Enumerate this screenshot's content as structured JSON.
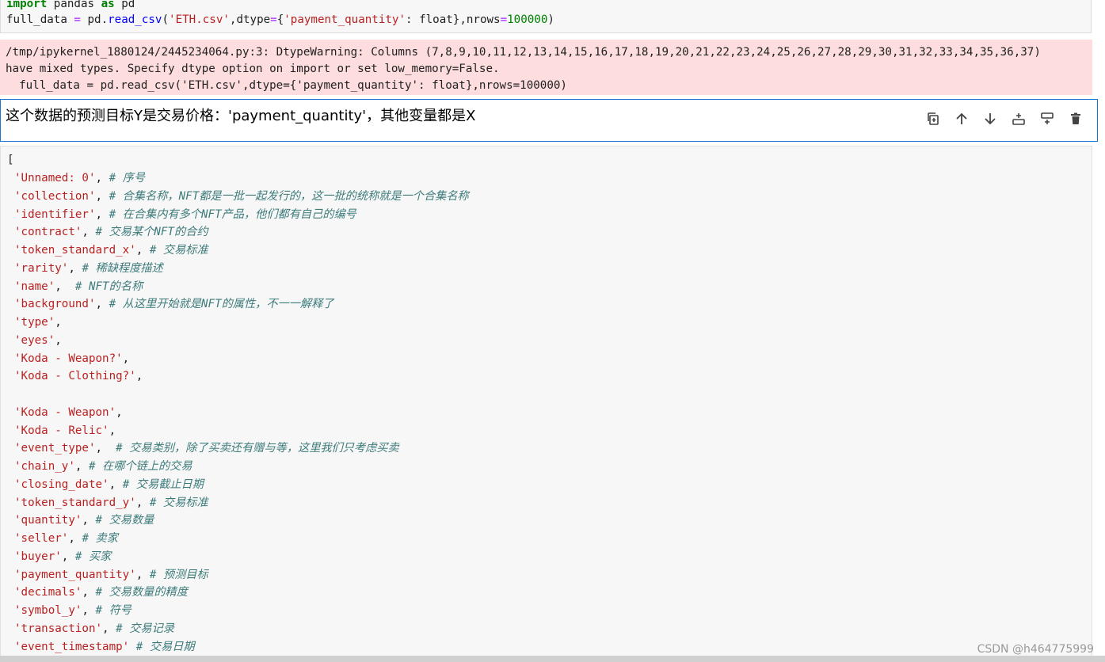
{
  "code_cell": {
    "line1": {
      "kw1": "import",
      "mid": " pandas ",
      "kw2": "as",
      "end": " pd"
    },
    "line2": {
      "a": "full_data ",
      "eq": "=",
      "b": " pd.",
      "fn": "read_csv",
      "c": "(",
      "s1": "'ETH.csv'",
      "d": ",dtype",
      "eq2": "=",
      "e": "{",
      "s2": "'payment_quantity'",
      "f": ": float},nrows",
      "eq3": "=",
      "num": "100000",
      "g": ")"
    }
  },
  "warning": {
    "line1": "/tmp/ipykernel_1880124/2445234064.py:3: DtypeWarning: Columns (7,8,9,10,11,12,13,14,15,16,17,18,19,20,21,22,23,24,25,26,27,28,29,30,31,32,33,34,35,36,37)",
    "line2": "have mixed types. Specify dtype option on import or set low_memory=False.",
    "line3": "  full_data = pd.read_csv('ETH.csv',dtype={'payment_quantity': float},nrows=100000)"
  },
  "markdown": {
    "text": "这个数据的预测目标Y是交易价格：'payment_quantity'，其他变量都是X"
  },
  "list": {
    "open": "[",
    "items": [
      {
        "name": "'Unnamed: 0'",
        "sep": ", ",
        "comment": "# 序号"
      },
      {
        "name": "'collection'",
        "sep": ", ",
        "comment": "# 合集名称，NFT都是一批一起发行的，这一批的统称就是一个合集名称"
      },
      {
        "name": "'identifier'",
        "sep": ", ",
        "comment": "# 在合集内有多个NFT产品，他们都有自己的编号"
      },
      {
        "name": "'contract'",
        "sep": ", ",
        "comment": "# 交易某个NFT的合约"
      },
      {
        "name": "'token_standard_x'",
        "sep": ", ",
        "comment": "# 交易标准"
      },
      {
        "name": "'rarity'",
        "sep": ", ",
        "comment": "# 稀缺程度描述"
      },
      {
        "name": "'name'",
        "sep": ",  ",
        "comment": "# NFT的名称"
      },
      {
        "name": "'background'",
        "sep": ", ",
        "comment": "# 从这里开始就是NFT的属性，不一一解释了"
      },
      {
        "name": "'type'",
        "sep": ",",
        "comment": ""
      },
      {
        "name": "'eyes'",
        "sep": ",",
        "comment": ""
      },
      {
        "name": "'Koda - Weapon?'",
        "sep": ",",
        "comment": ""
      },
      {
        "name": "'Koda - Clothing?'",
        "sep": ",",
        "comment": ""
      },
      {
        "name": "",
        "sep": "",
        "comment": ""
      },
      {
        "name": "'Koda - Weapon'",
        "sep": ",",
        "comment": ""
      },
      {
        "name": "'Koda - Relic'",
        "sep": ",",
        "comment": ""
      },
      {
        "name": "'event_type'",
        "sep": ",  ",
        "comment": "# 交易类别，除了买卖还有赠与等，这里我们只考虑买卖"
      },
      {
        "name": "'chain_y'",
        "sep": ", ",
        "comment": "# 在哪个链上的交易"
      },
      {
        "name": "'closing_date'",
        "sep": ", ",
        "comment": "# 交易截止日期"
      },
      {
        "name": "'token_standard_y'",
        "sep": ", ",
        "comment": "# 交易标准"
      },
      {
        "name": "'quantity'",
        "sep": ", ",
        "comment": "# 交易数量"
      },
      {
        "name": "'seller'",
        "sep": ", ",
        "comment": "# 卖家"
      },
      {
        "name": "'buyer'",
        "sep": ", ",
        "comment": "# 买家"
      },
      {
        "name": "'payment_quantity'",
        "sep": ", ",
        "comment": "# 预测目标"
      },
      {
        "name": "'decimals'",
        "sep": ", ",
        "comment": "# 交易数量的精度"
      },
      {
        "name": "'symbol_y'",
        "sep": ", ",
        "comment": "# 符号"
      },
      {
        "name": "'transaction'",
        "sep": ", ",
        "comment": "# 交易记录"
      },
      {
        "name": "'event_timestamp'",
        "sep": " ",
        "comment": "# 交易日期"
      }
    ]
  },
  "watermark": "CSDN @h464775999"
}
